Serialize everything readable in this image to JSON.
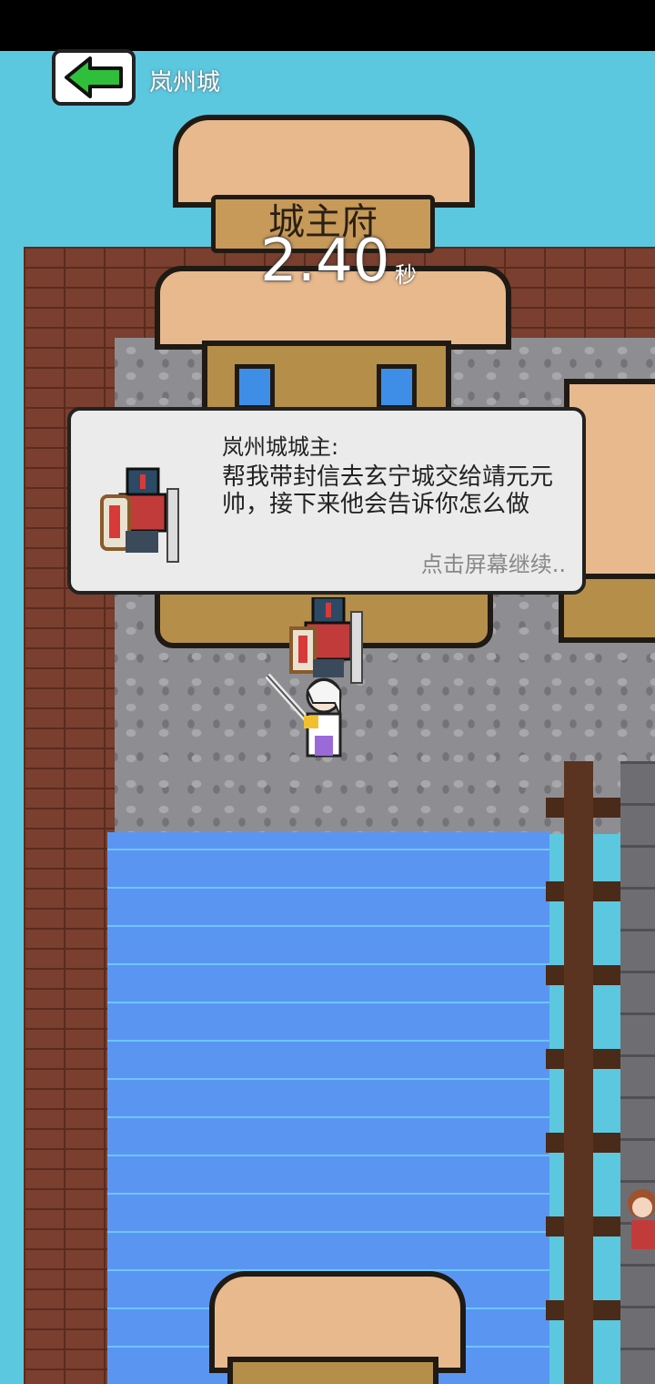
{
  "top_bar": {
    "back_icon": "arrow-left-icon",
    "city_name": "岚州城"
  },
  "timer": {
    "value": "2.40",
    "unit": "秒"
  },
  "scene": {
    "sign_text": "城主府"
  },
  "dialog": {
    "speaker": "岚州城城主:",
    "message": "帮我带封信去玄宁城交给靖元元帅，接下来他会告诉你怎么做",
    "continue_hint": "点击屏幕继续.."
  },
  "colors": {
    "sky": "#5bc8e0",
    "water": "#5b95f2",
    "dialog_bg": "#ebebeb",
    "back_arrow": "#2fbf3a"
  }
}
